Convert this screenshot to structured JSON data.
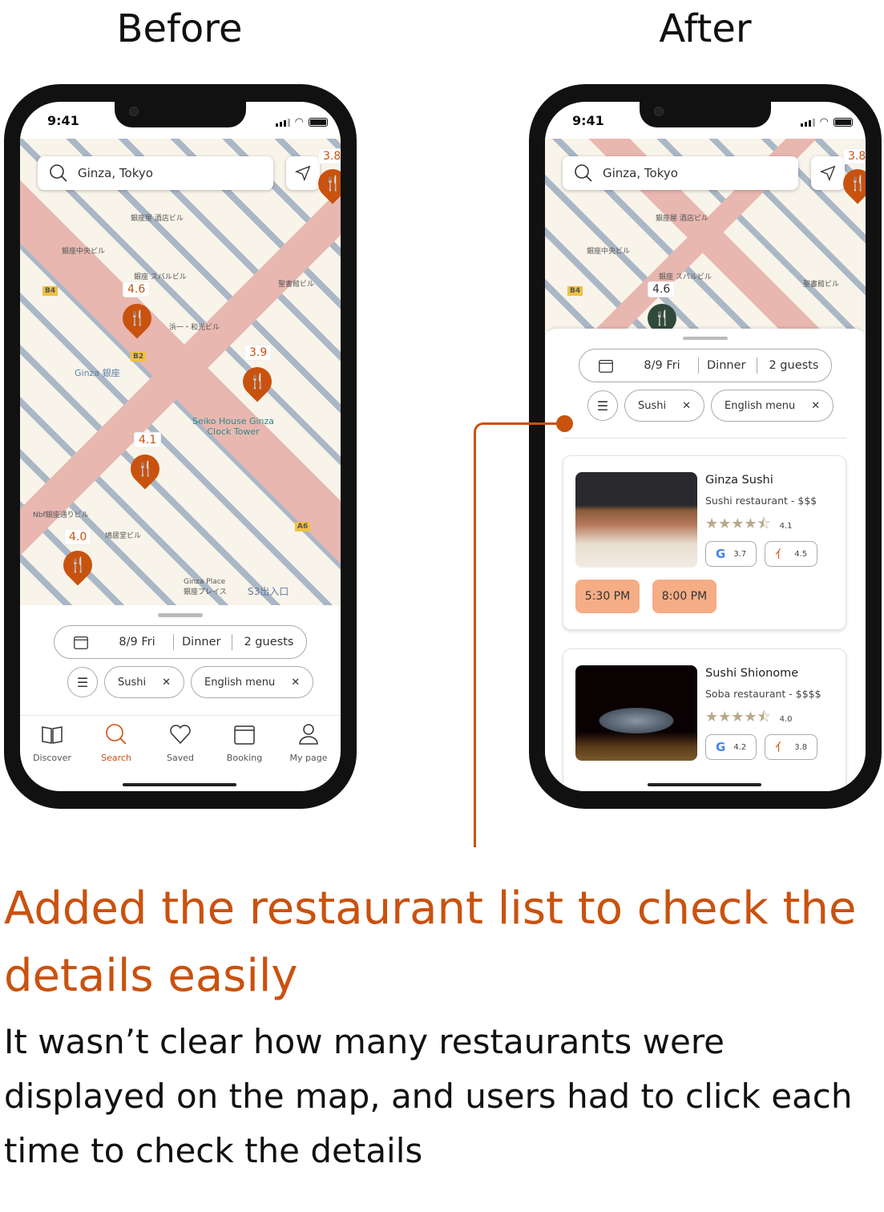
{
  "headings": {
    "before": "Before",
    "after": "After"
  },
  "phone": {
    "time": "9:41"
  },
  "search": {
    "placeholder": "Ginza, Tokyo"
  },
  "map": {
    "ratings": [
      "3.8",
      "4.6",
      "3.9",
      "4.1",
      "4.0"
    ],
    "labels": [
      "銀座屋 酒店ビル",
      "銀座中央ビル",
      "銀座 スバルビル",
      "聖書館ビル",
      "浜一・和光ビル",
      "Ginza 銀座",
      "Seiko House Ginza Clock Tower",
      "Nbf銀座通りビル",
      "鳩居堂ビル",
      "Ginza Place 銀座プレイス",
      "S3出入口",
      "B4",
      "B2",
      "A6"
    ]
  },
  "filters": {
    "date": "8/9 Fri",
    "meal": "Dinner",
    "guests": "2 guests",
    "chips": [
      "Sushi",
      "English menu"
    ]
  },
  "tabs": [
    {
      "label": "Discover",
      "icon": "book-icon"
    },
    {
      "label": "Search",
      "icon": "search-icon",
      "active": true
    },
    {
      "label": "Saved",
      "icon": "heart-icon"
    },
    {
      "label": "Booking",
      "icon": "calendar-icon"
    },
    {
      "label": "My page",
      "icon": "user-icon"
    }
  ],
  "restaurants": [
    {
      "name": "Ginza Sushi",
      "type": "Sushi restaurant - $$$",
      "rating": "4.1",
      "stars": 4.5,
      "google": "3.7",
      "tabelog": "4.5",
      "slots": [
        "5:30 PM",
        "8:00 PM"
      ]
    },
    {
      "name": "Sushi Shionome",
      "type": "Soba restaurant - $$$$",
      "rating": "4.0",
      "stars": 4.5,
      "google": "4.2",
      "tabelog": "3.8"
    }
  ],
  "colors": {
    "accent": "#c9520f",
    "slot": "#f5ad85",
    "star": "#b7a98a"
  },
  "caption": {
    "title": "Added the restaurant list to check the details easily",
    "body": "It wasn’t clear how many restaurants were displayed on the map, and users had to click each time to check the details"
  }
}
